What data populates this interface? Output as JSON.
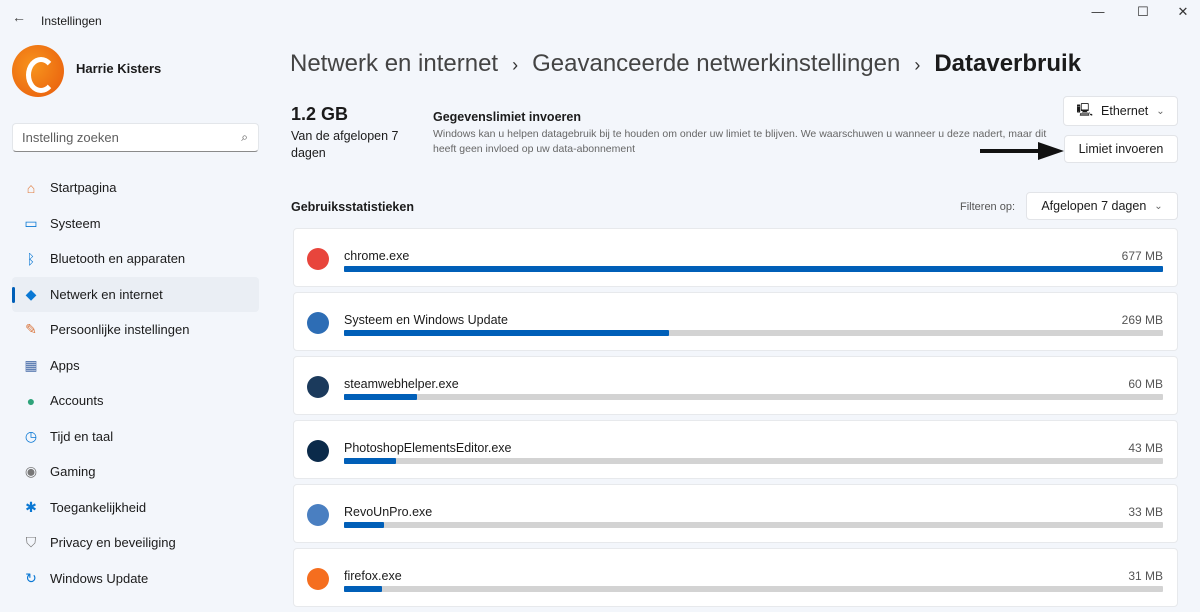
{
  "window": {
    "title": "Instellingen"
  },
  "user": {
    "name": "Harrie Kisters"
  },
  "search": {
    "placeholder": "Instelling zoeken"
  },
  "sidebar": {
    "items": [
      {
        "label": "Startpagina",
        "icon": "home-icon",
        "color": "#e07a3a"
      },
      {
        "label": "Systeem",
        "icon": "system-icon",
        "color": "#0a78d4"
      },
      {
        "label": "Bluetooth en apparaten",
        "icon": "bluetooth-icon",
        "color": "#0a78d4"
      },
      {
        "label": "Netwerk en internet",
        "icon": "wifi-icon",
        "color": "#0a78d4",
        "selected": true
      },
      {
        "label": "Persoonlijke instellingen",
        "icon": "brush-icon",
        "color": "#d9733a"
      },
      {
        "label": "Apps",
        "icon": "apps-icon",
        "color": "#4a6ea9"
      },
      {
        "label": "Accounts",
        "icon": "person-icon",
        "color": "#2ea37a"
      },
      {
        "label": "Tijd en taal",
        "icon": "globe-clock-icon",
        "color": "#0a78d4"
      },
      {
        "label": "Gaming",
        "icon": "gamepad-icon",
        "color": "#777"
      },
      {
        "label": "Toegankelijkheid",
        "icon": "accessibility-icon",
        "color": "#0a78d4"
      },
      {
        "label": "Privacy en beveiliging",
        "icon": "shield-icon",
        "color": "#777"
      },
      {
        "label": "Windows Update",
        "icon": "update-icon",
        "color": "#0a78d4"
      }
    ]
  },
  "breadcrumb": [
    "Netwerk en internet",
    "Geavanceerde netwerkinstellingen",
    "Dataverbruik"
  ],
  "summary": {
    "total": "1.2 GB",
    "period": "Van de afgelopen 7 dagen"
  },
  "limit": {
    "title": "Gegevenslimiet invoeren",
    "description": "Windows kan u helpen datagebruik bij te houden om onder uw limiet te blijven. We waarschuwen u wanneer u deze nadert, maar dit heeft geen invloed op uw data-abonnement",
    "button": "Limiet invoeren"
  },
  "adapter": {
    "selected": "Ethernet"
  },
  "stats": {
    "title": "Gebruiksstatistieken",
    "filter_label": "Filteren op:",
    "filter_value": "Afgelopen 7 dagen",
    "apps": [
      {
        "name": "chrome.exe",
        "usage": "677 MB",
        "mb": 677,
        "color": "#e8453c"
      },
      {
        "name": "Systeem en Windows Update",
        "usage": "269 MB",
        "mb": 269,
        "color": "#2d6db5"
      },
      {
        "name": "steamwebhelper.exe",
        "usage": "60 MB",
        "mb": 60,
        "color": "#1b3a5c"
      },
      {
        "name": "PhotoshopElementsEditor.exe",
        "usage": "43 MB",
        "mb": 43,
        "color": "#0b2a4a"
      },
      {
        "name": "RevoUnPro.exe",
        "usage": "33 MB",
        "mb": 33,
        "color": "#4a7fc1"
      },
      {
        "name": "firefox.exe",
        "usage": "31 MB",
        "mb": 31,
        "color": "#f56e1f"
      }
    ]
  }
}
